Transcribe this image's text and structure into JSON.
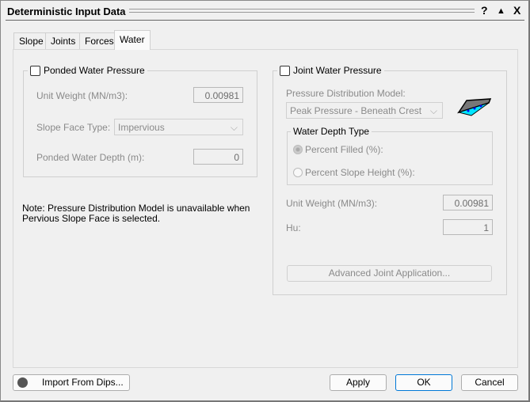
{
  "window": {
    "title": "Deterministic Input Data",
    "help": "?",
    "collapse": "▲",
    "close": "X"
  },
  "tabs": [
    {
      "label": "Slope"
    },
    {
      "label": "Joints"
    },
    {
      "label": "Forces"
    },
    {
      "label": "Water",
      "active": true
    }
  ],
  "ponded": {
    "label": "Ponded Water Pressure",
    "checked": false,
    "unit_weight_label": "Unit Weight (MN/m3):",
    "unit_weight": "0.00981",
    "face_type_label": "Slope Face Type:",
    "face_type": "Impervious",
    "depth_label": "Ponded Water Depth (m):",
    "depth": "0"
  },
  "note": "Note: Pressure Distribution Model is unavailable when Pervious Slope Face is selected.",
  "joint": {
    "label": "Joint Water Pressure",
    "checked": false,
    "model_label": "Pressure Distribution Model:",
    "model": "Peak Pressure - Beneath Crest",
    "depth_type_label": "Water Depth Type",
    "radio_filled": "Percent Filled (%):",
    "radio_height": "Percent Slope Height (%):",
    "selected": "Percent Filled (%):",
    "unit_weight_label": "Unit Weight (MN/m3):",
    "unit_weight": "0.00981",
    "hu_label": "Hu:",
    "hu": "1",
    "advanced": "Advanced Joint Application..."
  },
  "footer": {
    "import": "Import From Dips...",
    "apply": "Apply",
    "ok": "OK",
    "cancel": "Cancel"
  }
}
